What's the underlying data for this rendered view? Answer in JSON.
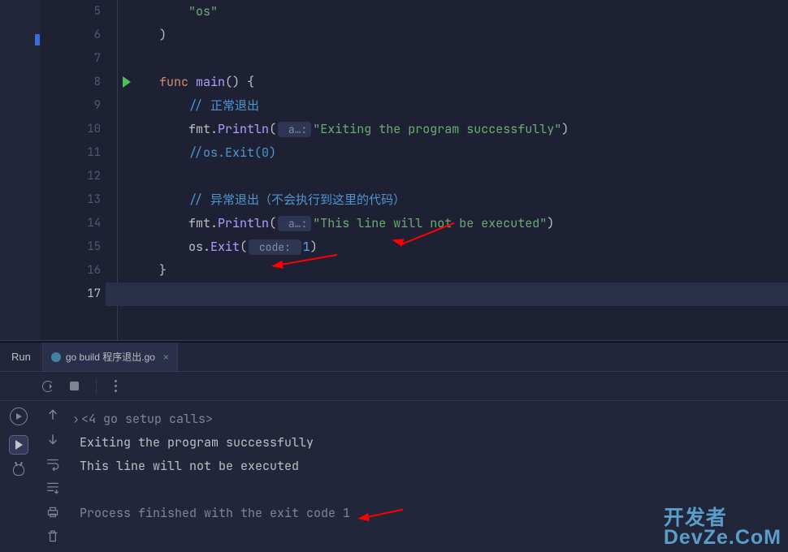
{
  "editor": {
    "line_start": 5,
    "lines": [
      {
        "n": 5,
        "code": [
          [
            "str",
            "\"os\""
          ]
        ],
        "indent": 2
      },
      {
        "n": 6,
        "code": [
          [
            "punc",
            ")"
          ]
        ],
        "indent": 1
      },
      {
        "n": 7,
        "code": [],
        "indent": 0
      },
      {
        "n": 8,
        "code": [
          [
            "kw",
            "func "
          ],
          [
            "fn",
            "main"
          ],
          [
            "punc",
            "() {"
          ]
        ],
        "indent": 1,
        "run": true
      },
      {
        "n": 9,
        "code": [
          [
            "cmt",
            "// 正常退出"
          ]
        ],
        "indent": 2
      },
      {
        "n": 10,
        "code": [
          [
            "pkg",
            "fmt"
          ],
          [
            "punc",
            "."
          ],
          [
            "fn",
            "Println"
          ],
          [
            "punc",
            "("
          ],
          [
            "hint",
            " a…:"
          ],
          [
            "str",
            "\"Exiting the program successfully\""
          ],
          [
            "punc",
            ")"
          ]
        ],
        "indent": 2
      },
      {
        "n": 11,
        "code": [
          [
            "cmt",
            "//os.Exit(0)"
          ]
        ],
        "indent": 2
      },
      {
        "n": 12,
        "code": [],
        "indent": 0
      },
      {
        "n": 13,
        "code": [
          [
            "cmt",
            "// 异常退出（不会执行到这里的代码）"
          ]
        ],
        "indent": 2
      },
      {
        "n": 14,
        "code": [
          [
            "pkg",
            "fmt"
          ],
          [
            "punc",
            "."
          ],
          [
            "fn",
            "Println"
          ],
          [
            "punc",
            "("
          ],
          [
            "hint",
            " a…:"
          ],
          [
            "str",
            "\"This line will not be executed\""
          ],
          [
            "punc",
            ")"
          ]
        ],
        "indent": 2
      },
      {
        "n": 15,
        "code": [
          [
            "pkg",
            "os"
          ],
          [
            "punc",
            "."
          ],
          [
            "fn",
            "Exit"
          ],
          [
            "punc",
            "("
          ],
          [
            "hint",
            " code: "
          ],
          [
            "num",
            "1"
          ],
          [
            "punc",
            ")"
          ]
        ],
        "indent": 2
      },
      {
        "n": 16,
        "code": [
          [
            "punc",
            "}"
          ]
        ],
        "indent": 1
      },
      {
        "n": 17,
        "code": [],
        "indent": 0,
        "current": true
      }
    ]
  },
  "panel": {
    "title": "Run",
    "tab_label": "go build 程序退出.go",
    "console": {
      "fold_line": "<4 go setup calls>",
      "lines": [
        "Exiting the program successfully",
        "This line will not be executed",
        "",
        "Process finished with the exit code 1"
      ]
    }
  },
  "watermark": {
    "line1": "开发者",
    "line2": "DevZe.CoM"
  }
}
